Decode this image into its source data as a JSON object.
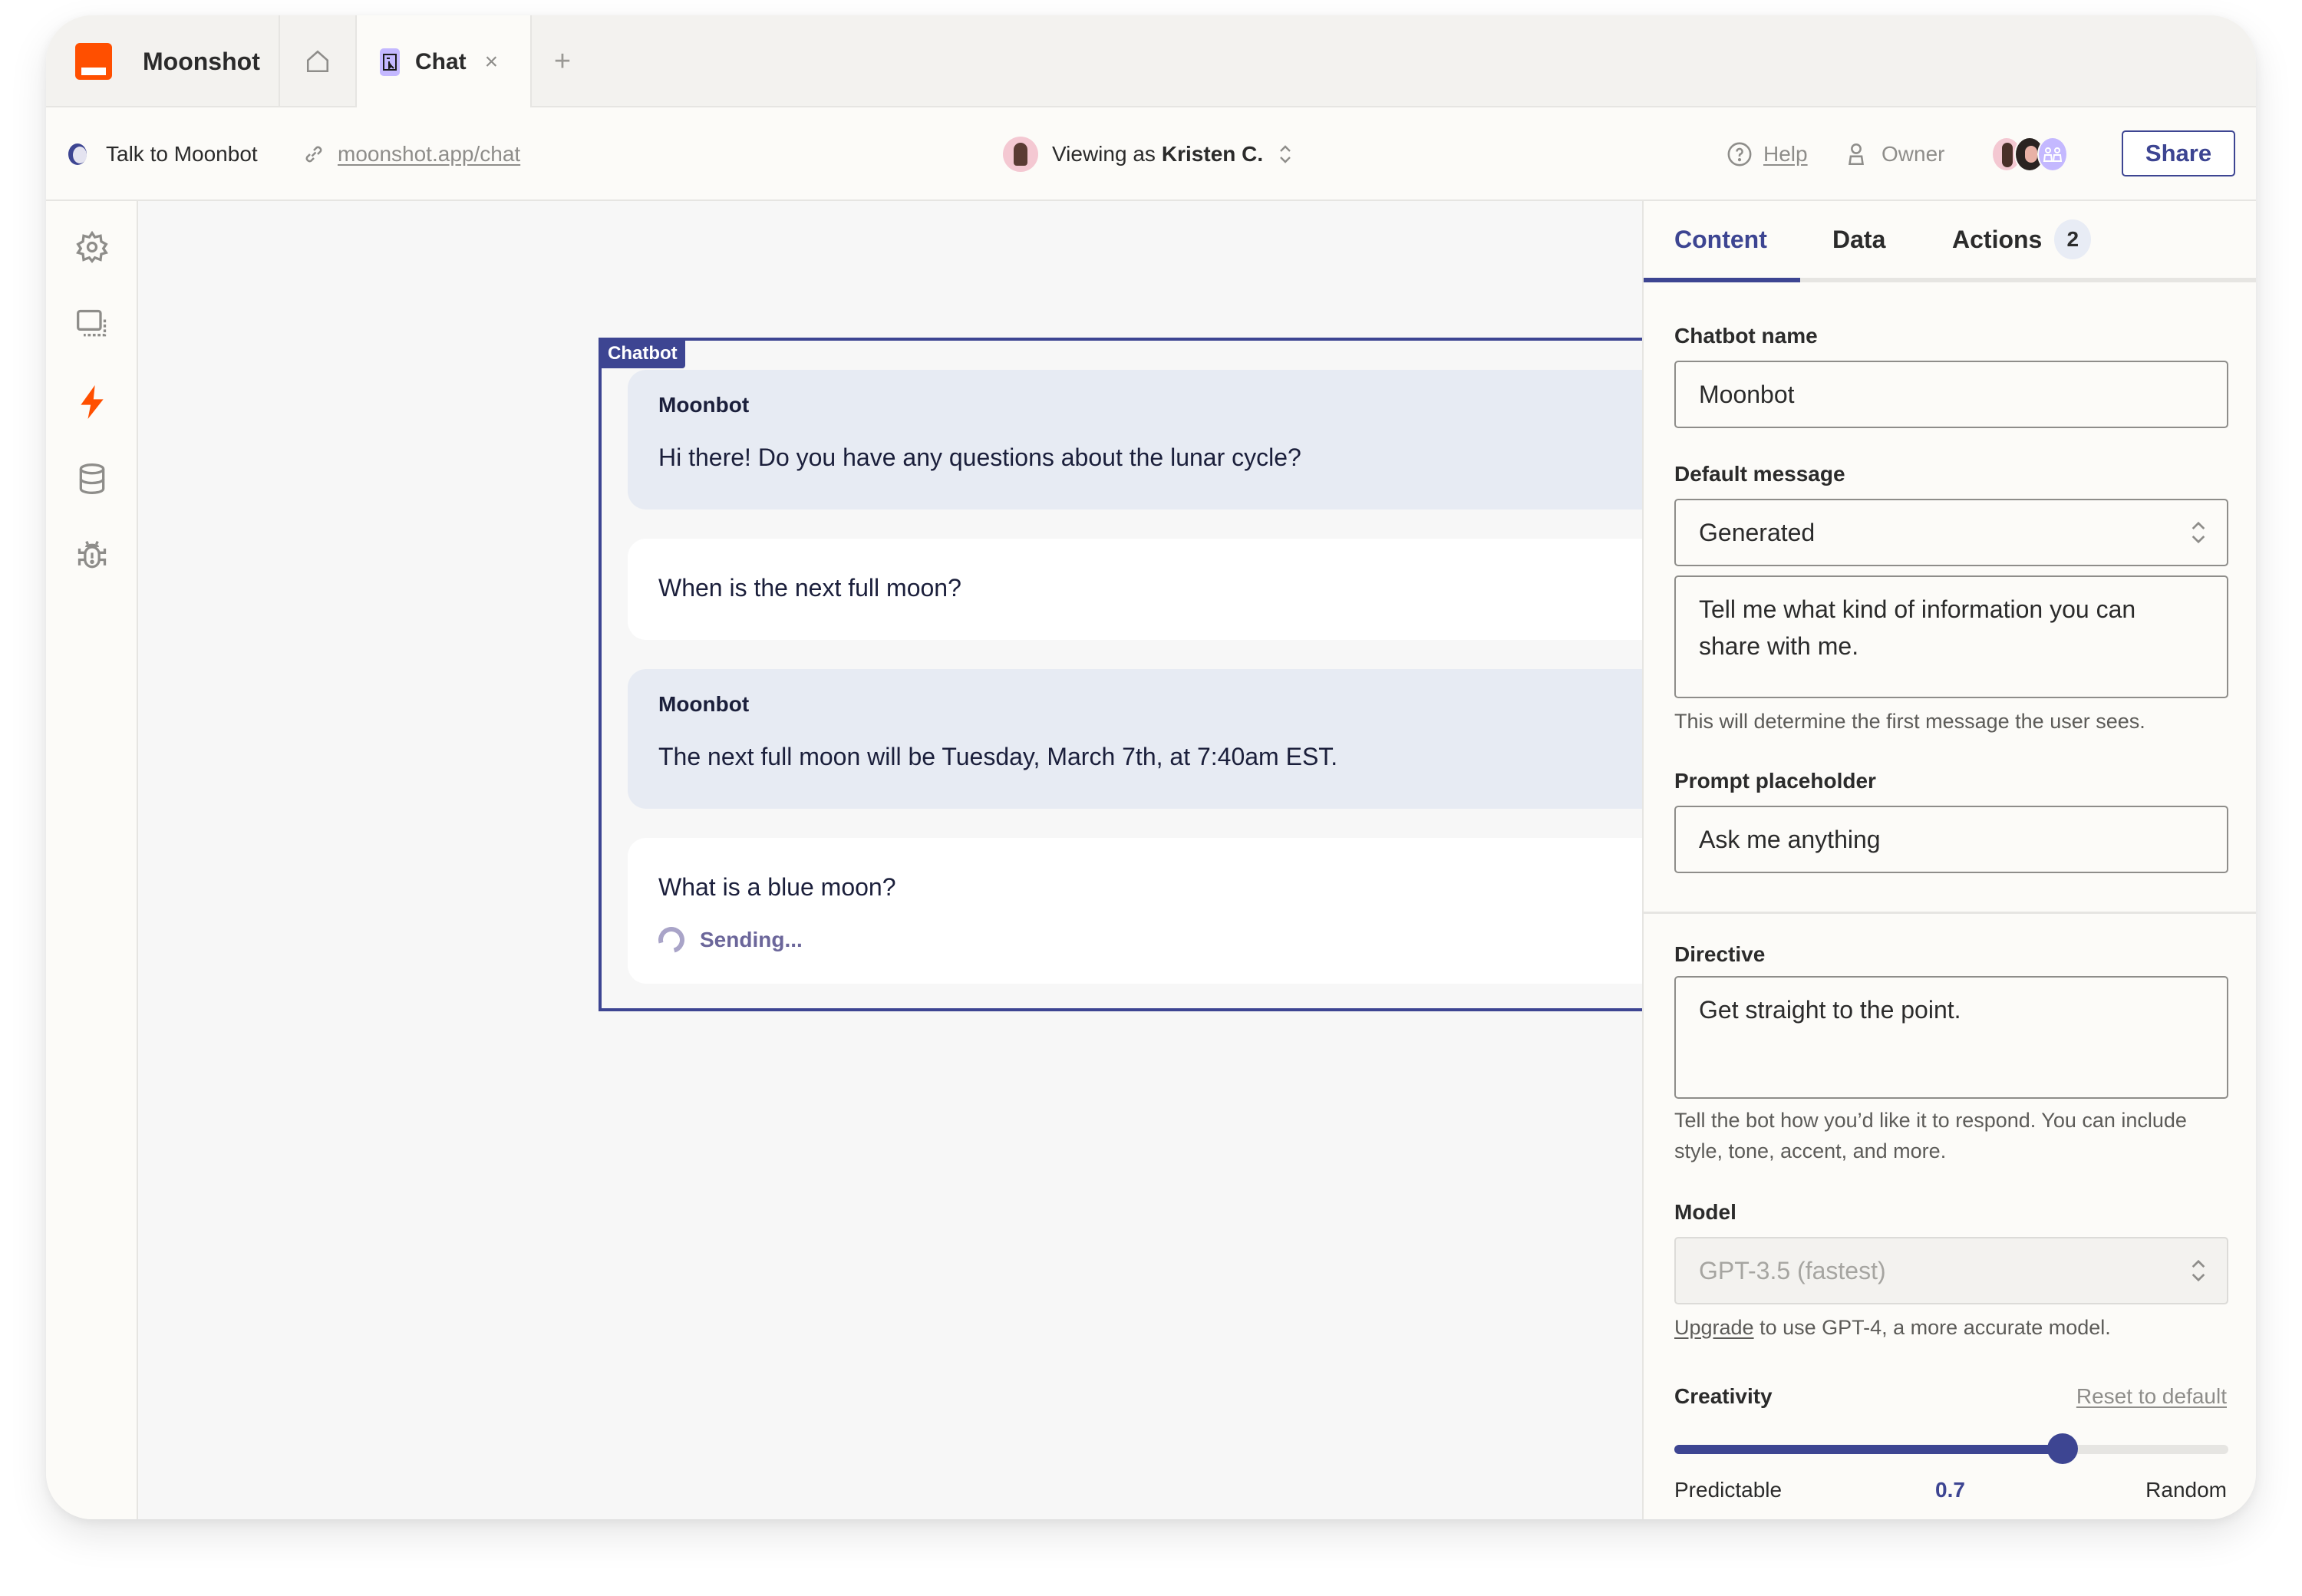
{
  "app": {
    "brand_name": "Moonshot",
    "brand_color": "#ff4f00",
    "accent_color": "#3d4592"
  },
  "tabs": {
    "home_icon": "home-icon",
    "active_tab_label": "Chat",
    "active_tab_icon": "interface-cursor-icon",
    "close_icon": "close-icon",
    "add_icon": "plus-icon",
    "add_symbol": "+",
    "close_symbol": "×"
  },
  "toolbar": {
    "app_label": "Talk to Moonbot",
    "url": "moonshot.app/chat",
    "viewing_prefix": "Viewing as",
    "viewing_name": "Kristen C.",
    "help_label": "Help",
    "owner_label": "Owner",
    "share_label": "Share"
  },
  "sidebar": {
    "items": [
      {
        "name": "settings",
        "icon": "gear-icon",
        "active": false
      },
      {
        "name": "interfaces",
        "icon": "screen-icon",
        "active": false
      },
      {
        "name": "automations",
        "icon": "bolt-icon",
        "active": true
      },
      {
        "name": "data",
        "icon": "database-icon",
        "active": false
      },
      {
        "name": "debug",
        "icon": "bug-icon",
        "active": false
      }
    ]
  },
  "canvas": {
    "component_tag": "Chatbot",
    "messages": [
      {
        "role": "bot",
        "sender": "Moonbot",
        "text": "Hi there! Do you have any questions about the lunar cycle?"
      },
      {
        "role": "user",
        "text": "When is the next full moon?"
      },
      {
        "role": "bot",
        "sender": "Moonbot",
        "text": "The next full moon will be Tuesday, March 7th, at 7:40am EST."
      },
      {
        "role": "user",
        "text": "What is a blue moon?",
        "status": "Sending..."
      }
    ]
  },
  "panel": {
    "tabs": [
      {
        "label": "Content",
        "active": true
      },
      {
        "label": "Data",
        "active": false
      },
      {
        "label": "Actions",
        "active": false,
        "badge": "2"
      }
    ],
    "chatbot_name": {
      "label": "Chatbot name",
      "value": "Moonbot"
    },
    "default_message": {
      "label": "Default message",
      "select_value": "Generated",
      "textarea_value": "Tell me what kind of information you can share with me.",
      "help": "This will determine the first message the user sees."
    },
    "prompt_placeholder": {
      "label": "Prompt placeholder",
      "value": "Ask me anything"
    },
    "directive": {
      "label": "Directive",
      "value": "Get straight to the point.",
      "help": "Tell the bot how you’d like it to respond. You can include style, tone, accent, and more."
    },
    "model": {
      "label": "Model",
      "value": "GPT-3.5 (fastest)",
      "disabled": true,
      "upgrade_link": "Upgrade",
      "upgrade_text": " to use GPT-4, a more accurate model."
    },
    "creativity": {
      "label": "Creativity",
      "reset_label": "Reset to default",
      "value": 0.7,
      "value_label": "0.7",
      "min": 0,
      "max": 1,
      "min_label": "Predictable",
      "max_label": "Random"
    }
  }
}
